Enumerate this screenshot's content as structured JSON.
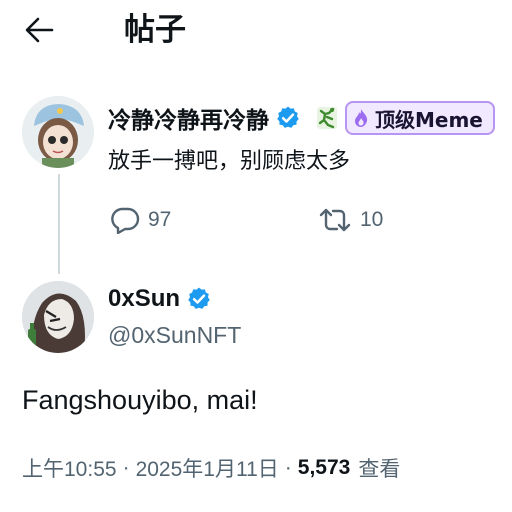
{
  "header": {
    "title": "帖子"
  },
  "reply": {
    "display_name": "冷静冷静再冷静",
    "badge_label": "顶级Meme",
    "text": "放手一搏吧，别顾虑太多",
    "reply_count": "97",
    "retweet_count": "10"
  },
  "post": {
    "display_name": "0xSun",
    "handle": "@0xSunNFT",
    "body": "Fangshouyibo, mai!",
    "time": "上午10:55",
    "separator": "·",
    "date": "2025年1月11日",
    "views_count": "5,573",
    "views_label": "查看"
  },
  "colors": {
    "verified": "#1d9bf0",
    "secondary_text": "#536471",
    "thread_line": "#cfd9de",
    "badge_border": "#b894f3"
  }
}
